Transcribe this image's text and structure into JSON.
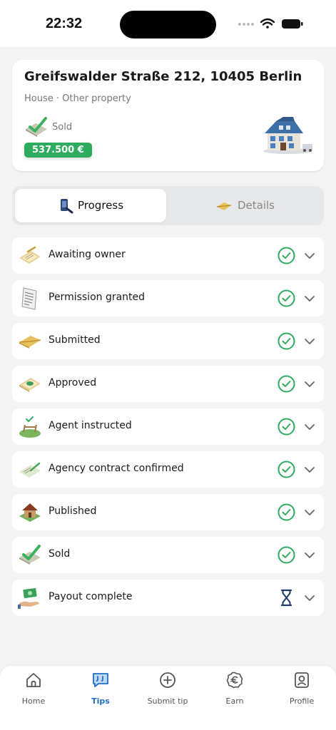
{
  "status_bar": {
    "time": "22:32"
  },
  "property": {
    "address": "Greifswalder Straße 212, 10405 Berlin",
    "type": "House · Other property",
    "status": "Sold",
    "price": "537.500 €",
    "status_icon": "sold-check-icon",
    "image": "house-icon"
  },
  "tabs": [
    {
      "label": "Progress",
      "icon": "phone-pen-icon",
      "active": true
    },
    {
      "label": "Details",
      "icon": "envelope-icon",
      "active": false
    }
  ],
  "steps": [
    {
      "label": "Awaiting owner",
      "icon": "contract-icon",
      "state": "done"
    },
    {
      "label": "Permission granted",
      "icon": "document-icon",
      "state": "done"
    },
    {
      "label": "Submitted",
      "icon": "envelope-icon",
      "state": "done"
    },
    {
      "label": "Approved",
      "icon": "approved-doc-icon",
      "state": "done"
    },
    {
      "label": "Agent instructed",
      "icon": "plot-icon",
      "state": "done"
    },
    {
      "label": "Agency contract confirmed",
      "icon": "signed-contract-icon",
      "state": "done"
    },
    {
      "label": "Published",
      "icon": "house-icon",
      "state": "done"
    },
    {
      "label": "Sold",
      "icon": "sold-check-icon",
      "state": "done"
    },
    {
      "label": "Payout complete",
      "icon": "cash-hand-icon",
      "state": "pending"
    }
  ],
  "colors": {
    "done": "#2dab5f",
    "pending": "#1e3d6b",
    "accent": "#1f6fc2",
    "price_badge": "#2dab5f"
  },
  "nav": [
    {
      "label": "Home",
      "icon": "home-icon",
      "active": false
    },
    {
      "label": "Tips",
      "icon": "tips-icon",
      "active": true
    },
    {
      "label": "Submit tip",
      "icon": "plus-circle-icon",
      "active": false
    },
    {
      "label": "Earn",
      "icon": "euro-icon",
      "active": false
    },
    {
      "label": "Profile",
      "icon": "profile-icon",
      "active": false
    }
  ]
}
